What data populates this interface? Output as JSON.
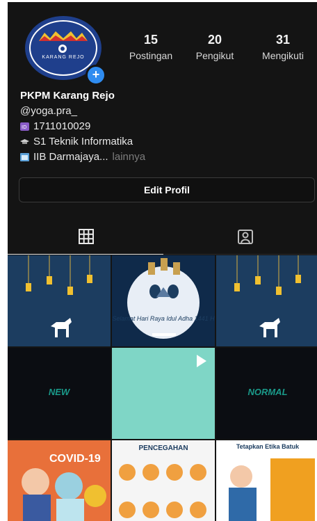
{
  "profile": {
    "name": "PKPM Karang Rejo",
    "username": "@yoga.pra_",
    "id_line": "1711010029",
    "study_line": "S1 Teknik Informatika",
    "campus_line": "IIB Darmajaya...",
    "more_label": "lainnya",
    "avatar_text": "KARANG REJO"
  },
  "stats": [
    {
      "value": "15",
      "label": "Postingan"
    },
    {
      "value": "20",
      "label": "Pengikut"
    },
    {
      "value": "31",
      "label": "Mengikuti"
    }
  ],
  "edit_button": "Edit Profil",
  "tabs": [
    {
      "icon": "grid-icon"
    },
    {
      "icon": "tagged-icon"
    }
  ],
  "posts": [
    {
      "type": "lanterns",
      "text": ""
    },
    {
      "type": "greeting",
      "text": "Selamat Hari Raya Idul Adha 1441 H"
    },
    {
      "type": "lanterns",
      "text": ""
    },
    {
      "type": "dark",
      "text": "NEW"
    },
    {
      "type": "teal-video",
      "text": ""
    },
    {
      "type": "dark",
      "text": "NORMAL"
    },
    {
      "type": "covid",
      "text": "COVID-19"
    },
    {
      "type": "infographic",
      "text": "PENCEGAHAN"
    },
    {
      "type": "infographic2",
      "text": "Tetapkan Etika Batuk"
    }
  ],
  "colors": {
    "background": "#141414",
    "accent": "#2f8cf0",
    "post_blue": "#1c3d60",
    "post_teal": "#7fd6c6"
  }
}
